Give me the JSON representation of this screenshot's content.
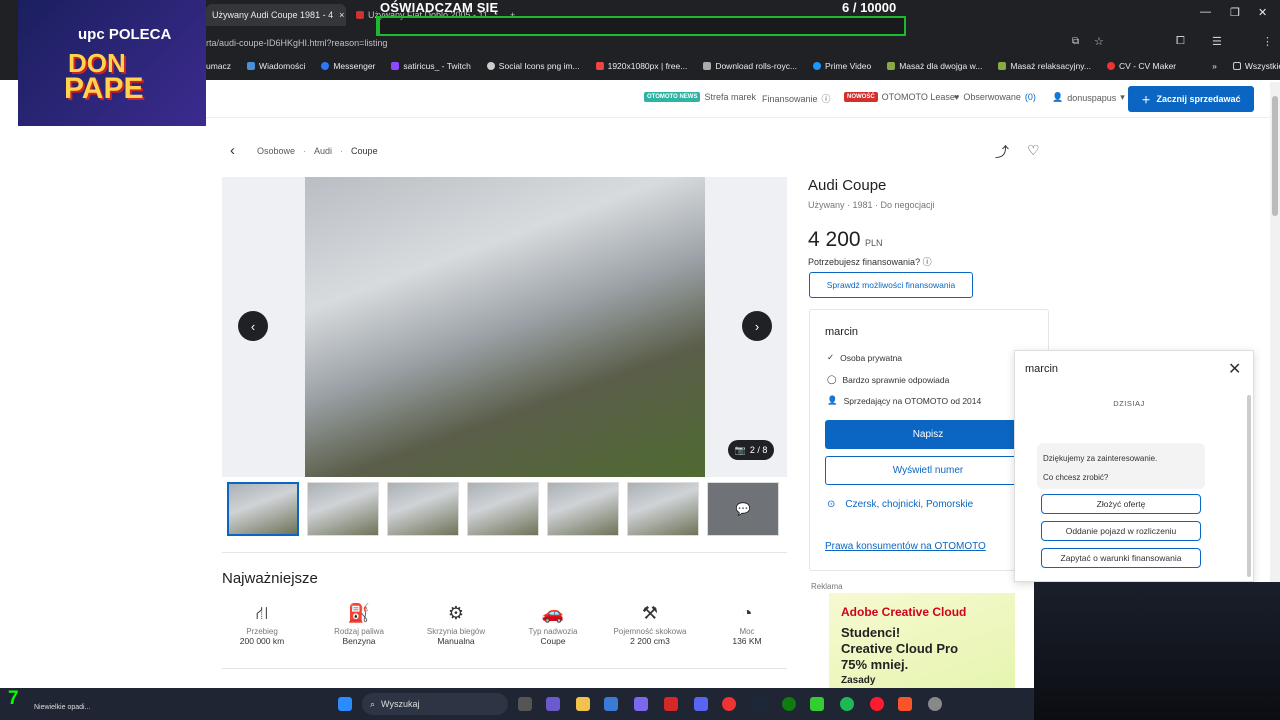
{
  "browser": {
    "tabs": [
      {
        "label": "Używany Audi Coupe 1981 - 4",
        "close": "×"
      },
      {
        "label": "Używany Fiat Doblo 2005 - 11"
      }
    ],
    "new_tab": "+",
    "url": "rta/audi-coupe-ID6HKgHI.html?reason=listing",
    "bookmarks": [
      {
        "label": "umacz"
      },
      {
        "label": "Wiadomości"
      },
      {
        "label": "Messenger"
      },
      {
        "label": "satiricus_ - Twitch"
      },
      {
        "label": "Social Icons png im..."
      },
      {
        "label": "1920x1080px | free..."
      },
      {
        "label": "Download rolls-royc..."
      },
      {
        "label": "Prime Video"
      },
      {
        "label": "Masaż dla dwojga w..."
      },
      {
        "label": "Masaż relaksacyjny..."
      },
      {
        "label": "CV - CV Maker"
      }
    ],
    "all_bookmarks": "Wszystkie zakładki"
  },
  "overlay": {
    "title": "OŚWIADCZAM SIĘ",
    "count": "6  / 10000",
    "progress": 0.0006
  },
  "logo": {
    "upc": "upc POLECA",
    "line1": "DON",
    "line2": "PAPE"
  },
  "header": {
    "news_badge": "OTOMOTO NEWS",
    "brands": "Strefa marek",
    "financing": "Finansowanie",
    "new_badge": "NOWOŚĆ",
    "lease": "OTOMOTO Lease",
    "watched": "Obserwowane",
    "watched_count": "(0)",
    "user": "donuspapus",
    "sell_button": "Zacznij sprzedawać"
  },
  "breadcrumb": [
    "Osobowe",
    "Audi",
    "Coupe"
  ],
  "gallery": {
    "counter": "2 / 8"
  },
  "listing": {
    "title": "Audi Coupe",
    "subtitle": "Używany · 1981 · Do negocjacji",
    "price": "4 200",
    "currency": "PLN",
    "financing_question": "Potrzebujesz finansowania?",
    "financing_button": "Sprawdź możliwości finansowania"
  },
  "seller": {
    "name": "marcin",
    "rows": [
      "Osoba prywatna",
      "Bardzo sprawnie odpowiada",
      "Sprzedający na OTOMOTO od 2014"
    ],
    "write_button": "Napisz",
    "phone_button": "Wyświetl numer",
    "location": "Czersk, chojnicki, Pomorskie",
    "consumer_link": "Prawa konsumentów na OTOMOTO"
  },
  "highlights": {
    "title": "Najważniejsze",
    "items": [
      {
        "icon": "road-icon",
        "label": "Przebieg",
        "value": "200 000 km"
      },
      {
        "icon": "fuel-icon",
        "label": "Rodzaj paliwa",
        "value": "Benzyna"
      },
      {
        "icon": "gearbox-icon",
        "label": "Skrzynia biegów",
        "value": "Manualna"
      },
      {
        "icon": "car-body-icon",
        "label": "Typ nadwozia",
        "value": "Coupe"
      },
      {
        "icon": "engine-icon",
        "label": "Pojemność skokowa",
        "value": "2 200 cm3"
      },
      {
        "icon": "gauge-icon",
        "label": "Moc",
        "value": "136 KM"
      }
    ]
  },
  "ad": {
    "label": "Reklama",
    "brand": "Adobe Creative Cloud",
    "line1": "Studenci!",
    "line2": "Creative Cloud Pro",
    "line3": "75% mniej.",
    "line4": "Zasady"
  },
  "chat": {
    "name": "marcin",
    "day": "DZISIAJ",
    "message1": "Dziękujemy za zainteresowanie.",
    "message2": "Co chcesz zrobić?",
    "options": [
      "Złożyć ofertę",
      "Oddanie pojazd w rozliczeniu",
      "Zapytać o warunki finansowania"
    ]
  },
  "taskbar": {
    "search": "Wyszukaj",
    "weather": "Niewielkie opadi...",
    "channel": "7"
  },
  "colors": {
    "accent": "#0a66c2",
    "overlay_green": "#1dba2b"
  }
}
